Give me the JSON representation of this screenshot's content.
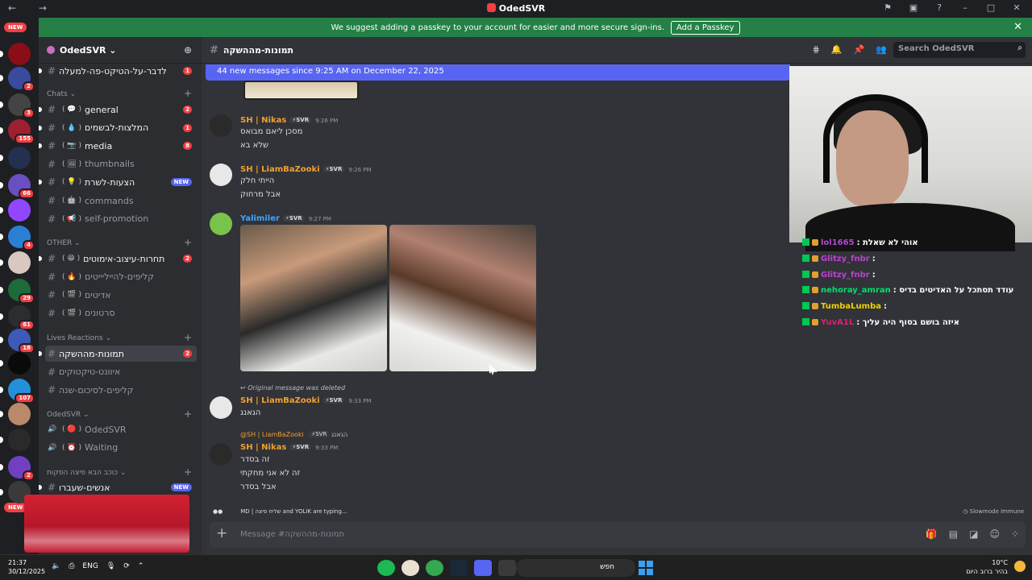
{
  "window": {
    "title": "OdedSVR",
    "nav": "← →"
  },
  "banner": {
    "text": "We suggest adding a passkey to your account for easier and more secure sign-ins.",
    "button": "Add a Passkey",
    "close": "✕"
  },
  "servers": {
    "new_top": "NEW",
    "new_bottom": "NEW",
    "items": [
      {
        "color": "#8b0d18",
        "badge": ""
      },
      {
        "color": "#3a4a9c",
        "badge": "2"
      },
      {
        "color": "#444444",
        "badge": "3"
      },
      {
        "color": "#9c2030",
        "badge": "155"
      },
      {
        "color": "#243050",
        "badge": ""
      },
      {
        "color": "#6a4fc0",
        "badge": "66"
      },
      {
        "color": "#9146ff",
        "badge": ""
      },
      {
        "color": "#2a7fd4",
        "badge": "4"
      },
      {
        "color": "#d8c8c0",
        "badge": ""
      },
      {
        "color": "#1d6a3a",
        "badge": "29"
      },
      {
        "color": "#2b2d31",
        "badge": "61"
      },
      {
        "color": "#3d5ab8",
        "badge": "18"
      },
      {
        "color": "#0a0a0a",
        "badge": ""
      },
      {
        "color": "#2490d8",
        "badge": "107"
      },
      {
        "color": "#b88a6a",
        "badge": ""
      },
      {
        "color": "#2a2a2a",
        "badge": ""
      },
      {
        "color": "#7040c0",
        "badge": "2"
      },
      {
        "color": "#3a3a3a",
        "badge": ""
      }
    ]
  },
  "sidebar": {
    "guild_name": "OdedSVR ⌄",
    "top_channel": {
      "name": "לדבר-על-הטיקט-פה-למעלה",
      "badge": "1"
    },
    "cat_chats": "Chats ⌄",
    "chats": [
      {
        "emo": "( 💬 )",
        "name": "general",
        "badge": "2"
      },
      {
        "emo": "( 💧 )",
        "name": "המלצות-לבשמים",
        "badge": "1"
      },
      {
        "emo": "( 📷 )",
        "name": "media",
        "badge": "8"
      },
      {
        "emo": "( 🖼 )",
        "name": "thumbnails",
        "badge": ""
      },
      {
        "emo": "( 💡 )",
        "name": "הצעות-לשרת",
        "new": "NEW"
      },
      {
        "emo": "( 🤖 )",
        "name": "commands",
        "badge": ""
      },
      {
        "emo": "( 📢 )",
        "name": "self-promotion",
        "badge": ""
      }
    ],
    "cat_other": "OTHER ⌄",
    "other": [
      {
        "emo": "( 😁 )",
        "name": "תחרות-עיצוב-אימוטים",
        "badge": "2"
      },
      {
        "emo": "( 🔥 )",
        "name": "קליפים-להייליייטים",
        "badge": ""
      },
      {
        "emo": "( 🎬 )",
        "name": "אדיטים",
        "badge": ""
      },
      {
        "emo": "( 🎬 )",
        "name": "סרטונים",
        "badge": ""
      }
    ],
    "cat_lives": "Lives Reactions ⌄",
    "lives": [
      {
        "name": "תמונות-מההשקה",
        "badge": "2"
      },
      {
        "name": "איוונט-טיקטוקים",
        "badge": ""
      },
      {
        "name": "קליפים-לסיכום-שנה",
        "badge": ""
      }
    ],
    "cat_voice": "OdedSVR ⌄",
    "voice": [
      {
        "emo": "( 🔴 )",
        "name": "OdedSVR"
      },
      {
        "emo": "( ⏰ )",
        "name": "Waiting"
      }
    ],
    "cat_pizza": "כוכב הבא פיצה הפקות ⌄",
    "pizza": {
      "name": "אנשים-שעברו",
      "new": "NEW"
    }
  },
  "chat": {
    "channel": "תמונות-מההשקה",
    "search_placeholder": "Search OdedSVR",
    "new_messages": "44 new messages since 9:25 AM on December 22, 2025",
    "messages": [
      {
        "author": "SH | Nikas",
        "color": "#f0a030",
        "tag": "⚡SVR",
        "time": "9:26 PM",
        "lines": [
          "מסכן ליאם מבואס",
          "שלא בא"
        ]
      },
      {
        "author": "SH | LiamBaZooki",
        "color": "#f0a030",
        "tag": "⚡SVR",
        "time": "9:26 PM",
        "lines": [
          "הייתי חלק",
          "אבל מרחוק"
        ]
      },
      {
        "author": "Yalimiler",
        "color": "#3ea6ff",
        "tag": "⚡SVR",
        "time": "9:27 PM",
        "lines": []
      },
      {
        "author": "SH | LiamBaZooki",
        "color": "#f0a030",
        "tag": "⚡SVR",
        "time": "9:33 PM",
        "lines": [
          "הגאנג"
        ],
        "reply": "Original message was deleted"
      },
      {
        "author": "SH | Nikas",
        "color": "#f0a030",
        "tag": "⚡SVR",
        "time": "9:33 PM",
        "lines": [
          "זה בסדר",
          "זה לא אני מחקתי",
          "אבל בסדר"
        ],
        "reply_author": "@SH | LiamBaZooki",
        "reply_tag": "⚡SVR",
        "reply_text": "הגאנג"
      }
    ],
    "typing": "MD | שליח פיצה and YOLIK are typing...",
    "slowmode": "Slowmode Immune",
    "composer_placeholder": "Message #תמונות-מההשקה"
  },
  "twitch_chat": [
    {
      "user": "lol1665",
      "color": "#b04ad0",
      "text": ": אוהי לא שאלת"
    },
    {
      "user": "Glitzy_fnbr",
      "color": "#c040d0",
      "text": ":"
    },
    {
      "user": "Glitzy_fnbr",
      "color": "#c040d0",
      "text": ":"
    },
    {
      "user": "nehoray_amran",
      "color": "#00e070",
      "text": ": עודד תסתכל על האדיטים בדיס"
    },
    {
      "user": "TumbaLumba",
      "color": "#f0d000",
      "text": ":"
    },
    {
      "user": "YuvA1L",
      "color": "#e02070",
      "text": ": איזה בושם בסוף היה עליך"
    }
  ],
  "taskbar": {
    "time": "21:37",
    "date": "30/12/2025",
    "lang": "ENG",
    "search": "חפש",
    "temp": "10°C",
    "weather": "בהיר ברוב היום"
  },
  "colors": {
    "accent": "#5865f2",
    "banner": "#248046",
    "badge": "#f23f43"
  }
}
